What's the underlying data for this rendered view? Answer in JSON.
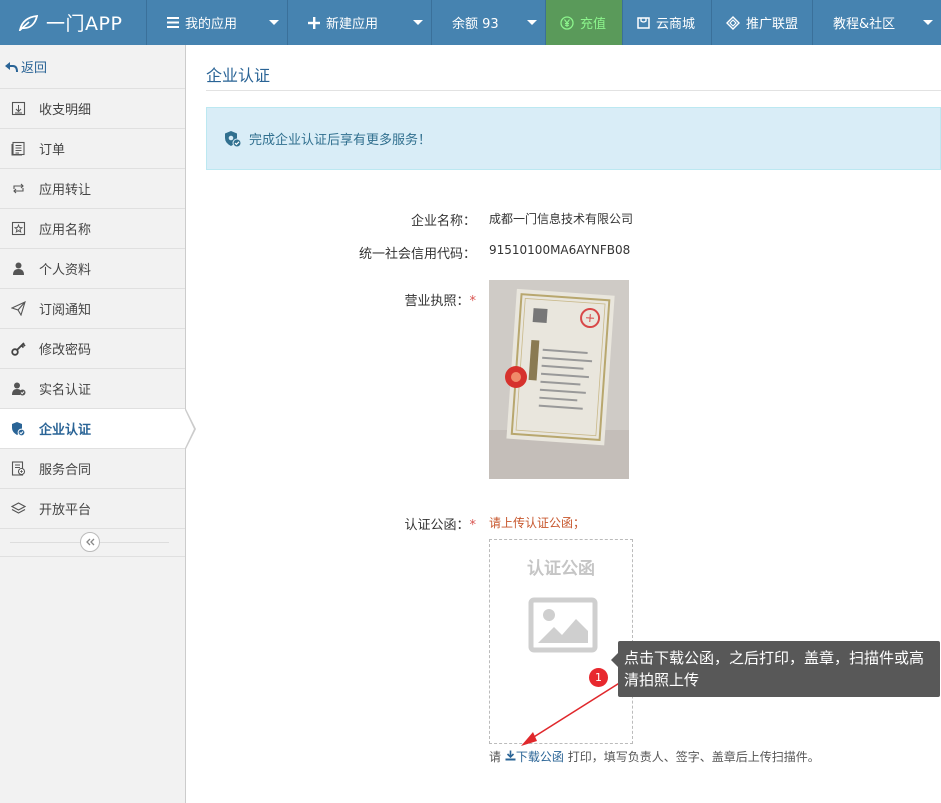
{
  "brand": {
    "name": "一门APP"
  },
  "nav": {
    "my_apps": "我的应用",
    "new_app": "新建应用",
    "balance": "余额 93",
    "recharge": "充值",
    "cloud_store": "云商城",
    "affiliate": "推广联盟",
    "tutorials": "教程&社区"
  },
  "sidebar": {
    "back": "返回",
    "items": [
      {
        "label": "收支明细",
        "icon": "ledger-icon"
      },
      {
        "label": "订单",
        "icon": "order-icon"
      },
      {
        "label": "应用转让",
        "icon": "transfer-icon"
      },
      {
        "label": "应用名称",
        "icon": "star-doc-icon"
      },
      {
        "label": "个人资料",
        "icon": "user-icon"
      },
      {
        "label": "订阅通知",
        "icon": "paper-plane-icon"
      },
      {
        "label": "修改密码",
        "icon": "key-icon"
      },
      {
        "label": "实名认证",
        "icon": "user-check-icon"
      },
      {
        "label": "企业认证",
        "icon": "shield-check-icon",
        "active": true
      },
      {
        "label": "服务合同",
        "icon": "contract-icon"
      },
      {
        "label": "开放平台",
        "icon": "layers-icon"
      }
    ]
  },
  "page": {
    "title": "企业认证",
    "alert": "完成企业认证后享有更多服务！"
  },
  "form": {
    "company_name_label": "企业名称：",
    "company_name": "成都一门信息技术有限公司",
    "credit_code_label": "统一社会信用代码：",
    "credit_code": "91510100MA6AYNFB08",
    "license_label": "营业执照：",
    "required_mark": "*",
    "letter_label": "认证公函：",
    "letter_warning": "请上传认证公函；",
    "upload_title": "认证公函",
    "hint_prefix": "请",
    "hint_link": "下载公函",
    "hint_suffix": "打印，填写负责人、签字、盖章后上传扫描件。"
  },
  "tooltip": {
    "step": "1",
    "text": "点击下载公函，之后打印，盖章，扫描件或高清拍照上传"
  },
  "colors": {
    "navbar": "#4683b0",
    "link": "#2a6496",
    "alert_bg": "#d9edf7",
    "required": "#d9534f",
    "badge": "#e8282e"
  }
}
